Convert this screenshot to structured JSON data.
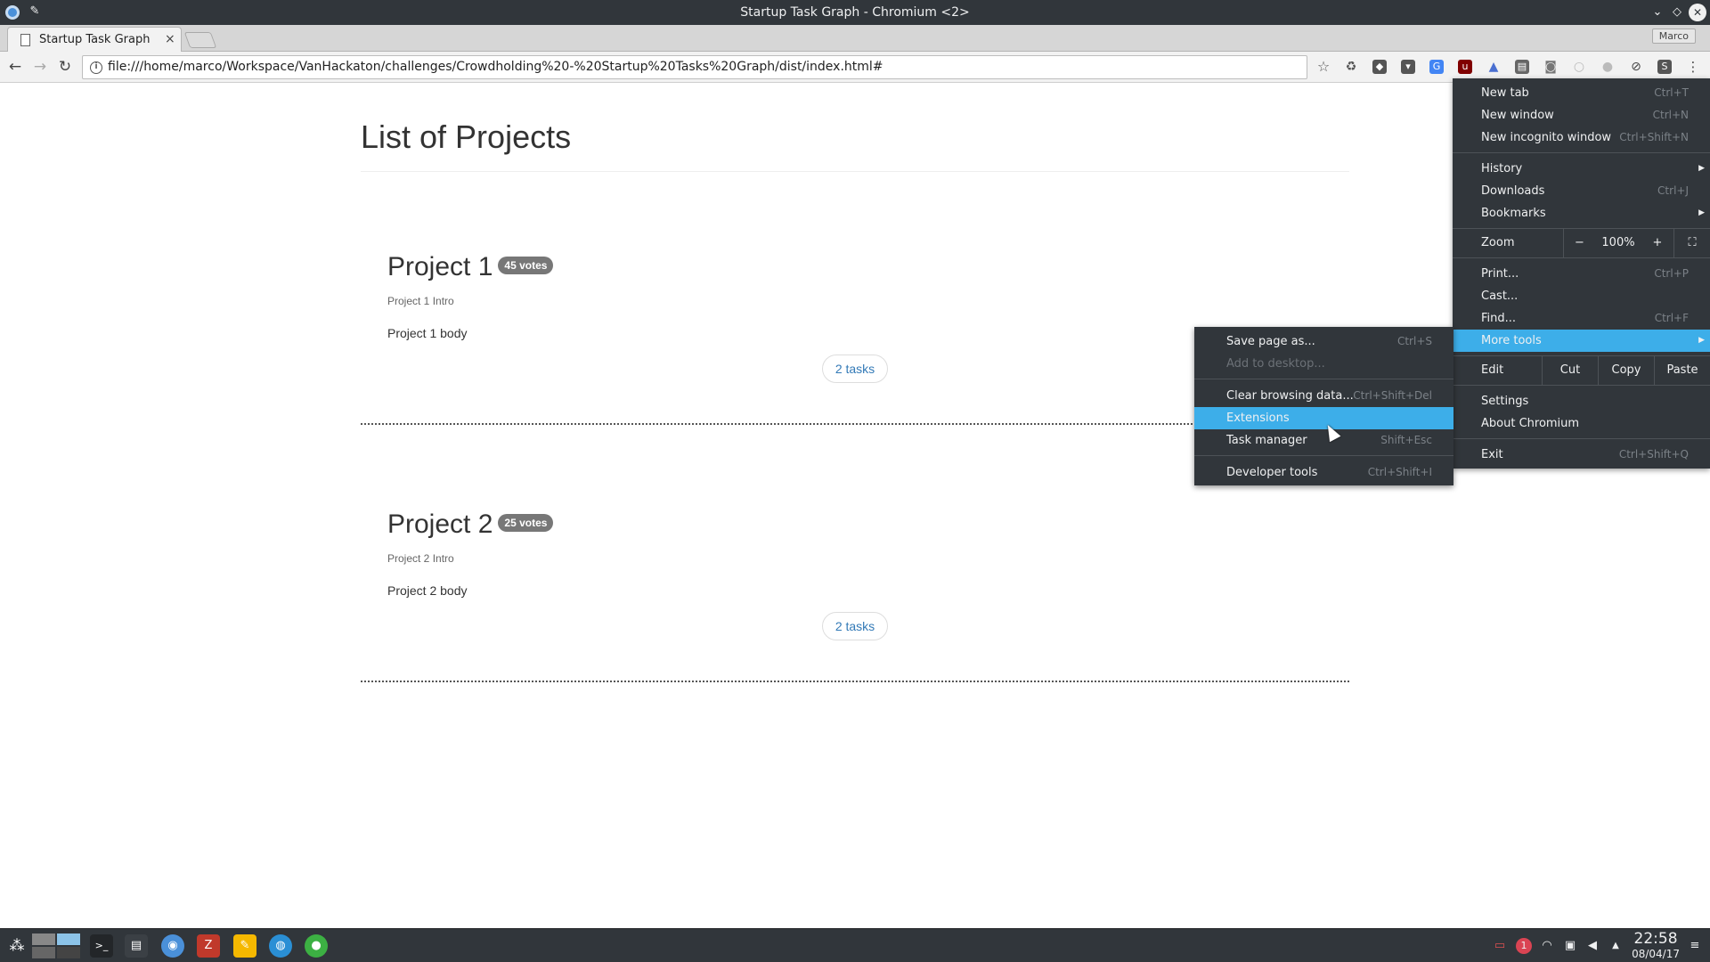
{
  "window": {
    "title": "Startup Task Graph - Chromium <2>"
  },
  "tabs": [
    {
      "label": "Startup Task Graph",
      "close": "×"
    }
  ],
  "profile": {
    "name": "Marco"
  },
  "toolbar": {
    "url": "file:///home/marco/Workspace/VanHackaton/challenges/Crowdholding%20-%20Startup%20Tasks%20Graph/dist/index.html#"
  },
  "page": {
    "title": "List of Projects",
    "projects": [
      {
        "name": "Project 1",
        "votes": "45 votes",
        "intro": "Project 1 Intro",
        "body": "Project 1 body",
        "tasks": "2 tasks"
      },
      {
        "name": "Project 2",
        "votes": "25 votes",
        "intro": "Project 2 Intro",
        "body": "Project 2 body",
        "tasks": "2 tasks"
      }
    ]
  },
  "menu": {
    "new_tab": {
      "label": "New tab",
      "shortcut": "Ctrl+T"
    },
    "new_window": {
      "label": "New window",
      "shortcut": "Ctrl+N"
    },
    "new_incognito": {
      "label": "New incognito window",
      "shortcut": "Ctrl+Shift+N"
    },
    "history": {
      "label": "History"
    },
    "downloads": {
      "label": "Downloads",
      "shortcut": "Ctrl+J"
    },
    "bookmarks": {
      "label": "Bookmarks"
    },
    "zoom": {
      "label": "Zoom",
      "minus": "−",
      "value": "100%",
      "plus": "+"
    },
    "print": {
      "label": "Print...",
      "shortcut": "Ctrl+P"
    },
    "cast": {
      "label": "Cast..."
    },
    "find": {
      "label": "Find...",
      "shortcut": "Ctrl+F"
    },
    "more_tools": {
      "label": "More tools"
    },
    "edit": {
      "label": "Edit",
      "cut": "Cut",
      "copy": "Copy",
      "paste": "Paste"
    },
    "settings": {
      "label": "Settings"
    },
    "about": {
      "label": "About Chromium"
    },
    "exit": {
      "label": "Exit",
      "shortcut": "Ctrl+Shift+Q"
    }
  },
  "submenu": {
    "save_page": {
      "label": "Save page as...",
      "shortcut": "Ctrl+S"
    },
    "add_desktop": {
      "label": "Add to desktop..."
    },
    "clear_data": {
      "label": "Clear browsing data...",
      "shortcut": "Ctrl+Shift+Del"
    },
    "extensions": {
      "label": "Extensions"
    },
    "task_manager": {
      "label": "Task manager",
      "shortcut": "Shift+Esc"
    },
    "dev_tools": {
      "label": "Developer tools",
      "shortcut": "Ctrl+Shift+I"
    }
  },
  "taskbar": {
    "notification_count": "1",
    "time": "22:58",
    "date": "08/04/17"
  },
  "colors": {
    "accent": "#3daee9",
    "dark_bg": "#31363b",
    "link": "#337ab7",
    "badge": "#777777"
  }
}
